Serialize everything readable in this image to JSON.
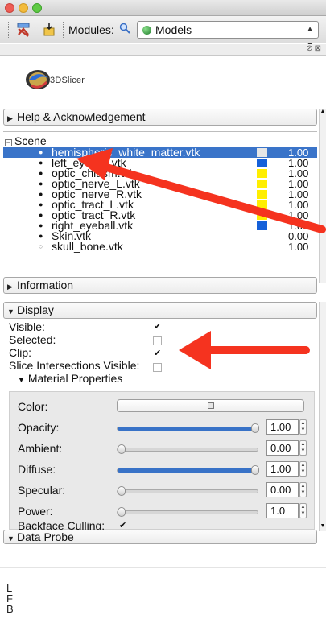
{
  "toolbar": {
    "modules_label": "Modules:",
    "module_selected": "Models",
    "search_icon": "magnifier-icon"
  },
  "logo": {
    "text": "3DSlicer"
  },
  "sections": {
    "help": "Help & Acknowledgement",
    "information": "Information",
    "display": "Display",
    "data_probe": "Data Probe"
  },
  "scene": {
    "root_label": "Scene",
    "models": [
      {
        "name": "hemispheric_white_matter.vtk",
        "color": "#e6e6e6",
        "opacity": "1.00",
        "selected": true
      },
      {
        "name": "left_eyeball.vtk",
        "color": "#1560d9",
        "opacity": "1.00",
        "selected": false
      },
      {
        "name": "optic_chiasm.vtk",
        "color": "#ffee00",
        "opacity": "1.00",
        "selected": false
      },
      {
        "name": "optic_nerve_L.vtk",
        "color": "#ffee00",
        "opacity": "1.00",
        "selected": false
      },
      {
        "name": "optic_nerve_R.vtk",
        "color": "#ffee00",
        "opacity": "1.00",
        "selected": false
      },
      {
        "name": "optic_tract_L.vtk",
        "color": "#ffee00",
        "opacity": "1.00",
        "selected": false
      },
      {
        "name": "optic_tract_R.vtk",
        "color": "#ffee00",
        "opacity": "1.00",
        "selected": false
      },
      {
        "name": "right_eyeball.vtk",
        "color": "#1560d9",
        "opacity": "1.00",
        "selected": false
      },
      {
        "name": "Skin.vtk",
        "color": "",
        "opacity": "0.00",
        "selected": false
      },
      {
        "name": "skull_bone.vtk",
        "color": "",
        "opacity": "1.00",
        "selected": false
      }
    ]
  },
  "display": {
    "visible_label": "Visible:",
    "visible_checked": true,
    "selected_label": "Selected:",
    "selected_checked": false,
    "clip_label": "Clip:",
    "clip_checked": true,
    "slice_label": "Slice Intersections Visible:",
    "slice_checked": false
  },
  "material": {
    "title": "Material Properties",
    "color_label": "Color:",
    "opacity_label": "Opacity:",
    "opacity_value": "1.00",
    "opacity_level": 1.0,
    "ambient_label": "Ambient:",
    "ambient_value": "0.00",
    "ambient_level": 0.0,
    "diffuse_label": "Diffuse:",
    "diffuse_value": "1.00",
    "diffuse_level": 1.0,
    "specular_label": "Specular:",
    "specular_value": "0.00",
    "specular_level": 0.0,
    "power_label": "Power:",
    "power_value": "1.0",
    "power_level": 0.0,
    "backface_label": "Backface Culling:",
    "backface_checked": true
  },
  "axes": {
    "l": "L",
    "f": "F",
    "b": "B"
  },
  "colors": {
    "selection": "#3a74c9",
    "annotation": "#f5331f",
    "slider_fill": "#3872c7"
  }
}
